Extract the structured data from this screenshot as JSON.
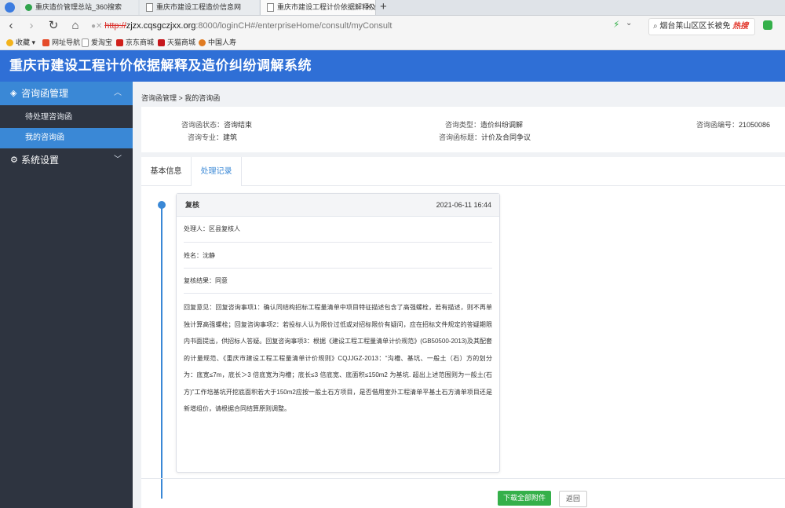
{
  "browser": {
    "tabs": [
      {
        "label": "重庆造价管理总站_360搜索",
        "active": false
      },
      {
        "label": "重庆市建设工程造价信息网",
        "active": false
      },
      {
        "label": "重庆市建设工程计价依据解释及",
        "active": true
      }
    ],
    "new_tab": "+",
    "close_tab": "×",
    "url": {
      "protocol": "http://",
      "host": "zjzx.cqsgczjxx.org",
      "path": ":8000/loginCH#/enterpriseHome/consult/myConsult"
    },
    "search": {
      "value": "烟台莱山区区长被免",
      "hot": "热搜"
    },
    "bookmarks": [
      "收藏",
      "网址导航",
      "爱淘宝",
      "京东商城",
      "天猫商城",
      "中国人寿"
    ]
  },
  "app": {
    "title": "重庆市建设工程计价依据解释及造价纠纷调解系统"
  },
  "sidebar": {
    "groups": [
      {
        "label": "咨询函管理",
        "open": true,
        "items": [
          {
            "label": "待处理咨询函",
            "active": false
          },
          {
            "label": "我的咨询函",
            "active": true
          }
        ]
      },
      {
        "label": "系统设置",
        "open": false,
        "items": []
      }
    ]
  },
  "breadcrumb": "咨询函管理 > 我的咨询函",
  "info": {
    "status_label": "咨询函状态：",
    "status_value": "咨询结束",
    "major_label": "咨询专业：",
    "major_value": "建筑",
    "type_label": "咨询类型：",
    "type_value": "造价纠纷调解",
    "subject_label": "咨询函标题：",
    "subject_value": "计价及合同争议",
    "number_label": "咨询函编号：",
    "number_value": "21050086"
  },
  "tabs": [
    {
      "label": "基本信息",
      "active": false
    },
    {
      "label": "处理记录",
      "active": true
    }
  ],
  "record": {
    "title": "复核",
    "date": "2021-06-11 16:44",
    "handler": "处理人：区县复核人",
    "name": "姓名：沈静",
    "result": "复核结果：同意",
    "opinion": "回复意见：回复咨询事项1：确认同结构招标工程量清单中项目特征描述包含了高强螺栓，若有描述，则不再单独计算高强螺栓；回复咨询事项2：若投标人认为限价过低或对招标限价有疑问，应在招标文件规定的答疑期限内书面提出，供招标人答疑。回复咨询事项3：根据《建设工程工程量清单计价规范》(GB50500-2013)及其配套的计量规范、《重庆市建设工程工程量清单计价规则》CQJJGZ-2013：“沟槽、基坑、一般土（石）方的划分为：底宽≤7m，底长＞3 倍底宽为沟槽；底长≤3 倍底宽、底面积≤150m2 为基坑. 超出上述范围则为一般土(石方)”工作培基坑开挖底面积若大于150m2应按一般土石方项目，是否借用室外工程清单平基土石方清单项目还是新增组价，请根据合同结算原则调整。"
  },
  "buttons": {
    "download": "下载全部附件",
    "back": "返回"
  },
  "colors": {
    "header": "#2f6fd6",
    "sidebar": "#2e3440",
    "accent": "#3a88d6",
    "download": "#35b04a"
  }
}
